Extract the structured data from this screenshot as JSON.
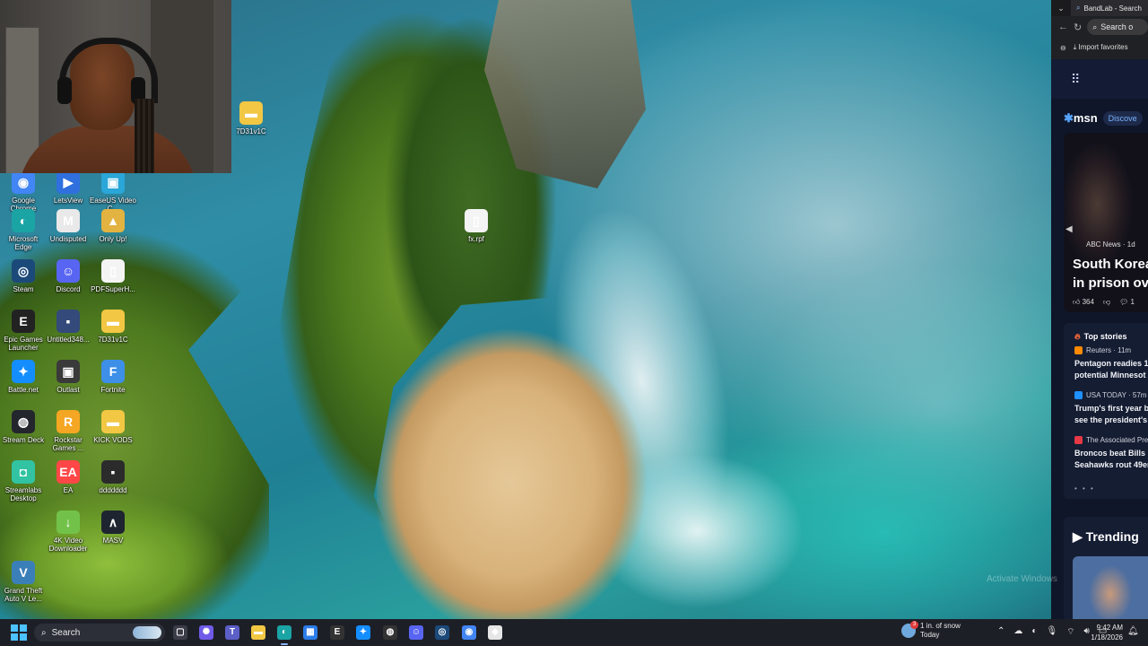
{
  "desktop": {
    "icons": [
      {
        "label": "Google Chrome",
        "glyph": "◉",
        "color": "#4285f4"
      },
      {
        "label": "LetsView",
        "glyph": "▶",
        "color": "#2f6fde"
      },
      {
        "label": "EaseUS Video C...",
        "glyph": "▣",
        "color": "#2aa6d8"
      },
      {
        "label": "7D31v1C",
        "glyph": "▬",
        "color": "#f2c744"
      },
      {
        "label": "Microsoft Edge",
        "glyph": "◐",
        "color": "#1aa4a4"
      },
      {
        "label": "Undisputed",
        "glyph": "M",
        "color": "#e9e9e9"
      },
      {
        "label": "Only Up!",
        "glyph": "▲",
        "color": "#e3b341"
      },
      {
        "label": "fx.rpf",
        "glyph": "▯",
        "color": "#f4f4f4"
      },
      {
        "label": "Steam",
        "glyph": "◎",
        "color": "#1b4a7a"
      },
      {
        "label": "Discord",
        "glyph": "☺",
        "color": "#5865f2"
      },
      {
        "label": "PDFSuperH...",
        "glyph": "▯",
        "color": "#f4f4f4"
      },
      {
        "label": "Epic Games Launcher",
        "glyph": "E",
        "color": "#222"
      },
      {
        "label": "Untitled348...",
        "glyph": "▪",
        "color": "#334a7a"
      },
      {
        "label": "7D31v1C",
        "glyph": "▬",
        "color": "#f2c744"
      },
      {
        "label": "Battle.net",
        "glyph": "✦",
        "color": "#148eff"
      },
      {
        "label": "Outlast",
        "glyph": "▣",
        "color": "#3a3a3a"
      },
      {
        "label": "Fortnite",
        "glyph": "F",
        "color": "#3d8fe8"
      },
      {
        "label": "Stream Deck",
        "glyph": "◍",
        "color": "#24262e"
      },
      {
        "label": "Rockstar Games ...",
        "glyph": "R",
        "color": "#f5a623"
      },
      {
        "label": "KICK VODS",
        "glyph": "▬",
        "color": "#f2c744"
      },
      {
        "label": "Streamlabs Desktop",
        "glyph": "◘",
        "color": "#31c3a2"
      },
      {
        "label": "EA",
        "glyph": "EA",
        "color": "#ff4747"
      },
      {
        "label": "ddddddd",
        "glyph": "▪",
        "color": "#2b2b2b"
      },
      {
        "label": "4K Video Downloader",
        "glyph": "↓",
        "color": "#72c24a"
      },
      {
        "label": "MASV",
        "glyph": "∧",
        "color": "#1e2430"
      },
      {
        "label": "Grand Theft Auto V Le...",
        "glyph": "V",
        "color": "#3b7fb8"
      }
    ]
  },
  "browser": {
    "tab_title": "BandLab - Search",
    "search_placeholder": "Search o",
    "favorites_label": "Import favorites",
    "msn": {
      "logo": "msn",
      "discover": "Discove",
      "hero_source": "ABC News · 1d",
      "hero_headline_1": "South Korea",
      "hero_headline_2": "in prison ov",
      "hero_likes": "364",
      "hero_comments": "1",
      "top_stories_title": "Top stories",
      "stories": [
        {
          "source": "Reuters · 11m",
          "line1": "Pentagon readies 1,",
          "line2": "potential Minnesot",
          "color": "#ff8a00"
        },
        {
          "source": "USA TODAY · 57m",
          "line1": "Trump's first year b",
          "line2": "see the president's",
          "color": "#1e90ff"
        },
        {
          "source": "The Associated Pre",
          "line1": "Broncos beat Bills in",
          "line2": "Seahawks rout 49er",
          "color": "#e63946"
        }
      ],
      "more_dots": "• • •",
      "trending_title": "Trending"
    }
  },
  "watermark": "Activate Windows",
  "taskbar": {
    "search_label": "Search",
    "weather_line1": "1 in. of snow",
    "weather_line2": "Today",
    "weather_badge": "3",
    "time": "9:42 AM",
    "date": "1/18/2026",
    "apps": [
      {
        "name": "task-view",
        "glyph": "▢",
        "color": "#3a3d48"
      },
      {
        "name": "copilot",
        "glyph": "✺",
        "color": "#6f5be8"
      },
      {
        "name": "teams",
        "glyph": "T",
        "color": "#5b5fc7"
      },
      {
        "name": "file-explorer",
        "glyph": "▬",
        "color": "#f2c744"
      },
      {
        "name": "edge",
        "glyph": "◐",
        "color": "#1aa4a4"
      },
      {
        "name": "store",
        "glyph": "▦",
        "color": "#2b7de9"
      },
      {
        "name": "epic",
        "glyph": "E",
        "color": "#333"
      },
      {
        "name": "battlenet",
        "glyph": "✦",
        "color": "#148eff"
      },
      {
        "name": "obs",
        "glyph": "◍",
        "color": "#333"
      },
      {
        "name": "discord",
        "glyph": "☺",
        "color": "#5865f2"
      },
      {
        "name": "steam",
        "glyph": "◎",
        "color": "#1b4a7a"
      },
      {
        "name": "chrome",
        "glyph": "◉",
        "color": "#4285f4"
      },
      {
        "name": "app",
        "glyph": "◈",
        "color": "#e6e6e6"
      }
    ]
  }
}
